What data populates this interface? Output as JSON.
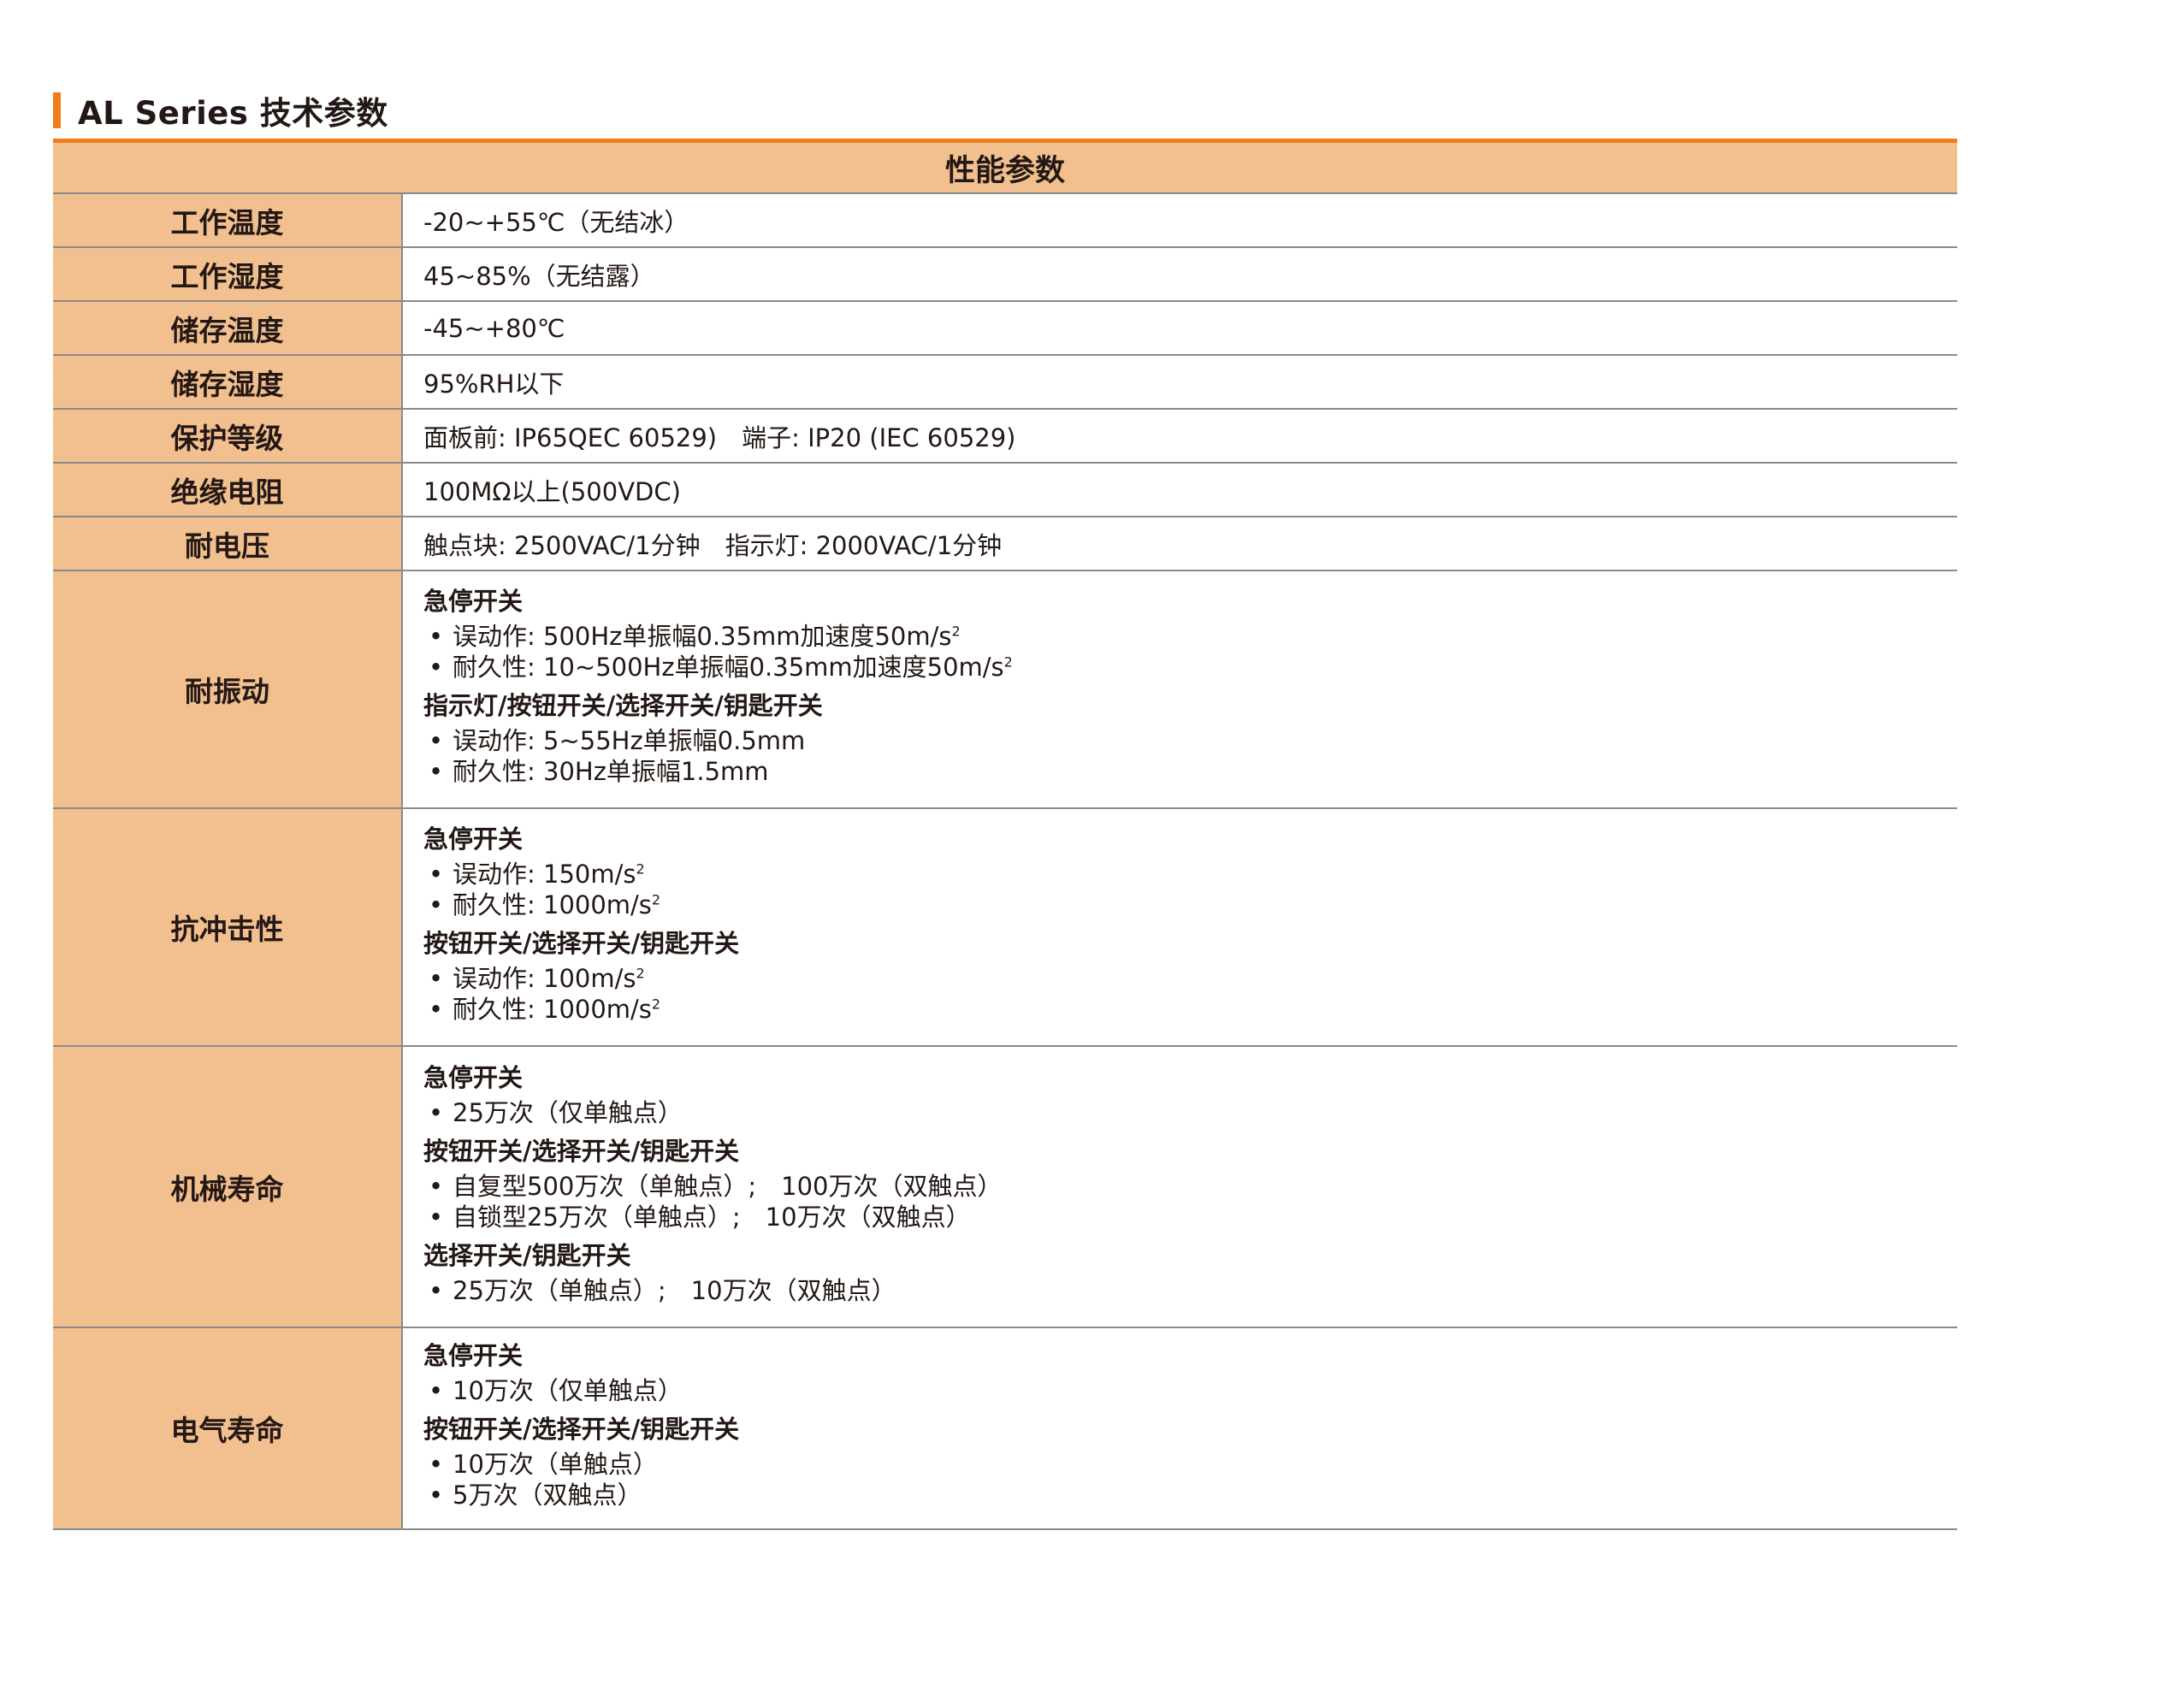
{
  "heading": {
    "title": "AL Series 技术参数",
    "accent": "#ee7d1e"
  },
  "table": {
    "header": "性能参数",
    "colors": {
      "label_bg": "#f2c08e",
      "accent_line": "#ee7d1e"
    },
    "simple_rows": [
      {
        "label": "工作温度",
        "value": "-20~+55℃（无结冰）"
      },
      {
        "label": "工作湿度",
        "value": "45~85%（无结露）"
      },
      {
        "label": "储存温度",
        "value": "-45~+80℃"
      },
      {
        "label": "储存湿度",
        "value": "95%RH以下"
      },
      {
        "label": "保护等级",
        "value": "面板前: IP65QEC 60529)　端子: IP20 (IEC 60529)"
      },
      {
        "label": "绝缘电阻",
        "value": "100MΩ以上(500VDC)"
      },
      {
        "label": "耐电压",
        "value": "触点块: 2500VAC/1分钟　指示灯: 2000VAC/1分钟"
      }
    ],
    "vibration": {
      "label": "耐振动",
      "groups": [
        {
          "title": "急停开关",
          "items": [
            "误动作: 500Hz单振幅0.35mm加速度50m/s",
            "耐久性: 10~500Hz单振幅0.35mm加速度50m/s"
          ],
          "sup": "2"
        },
        {
          "title": "指示灯/按钮开关/选择开关/钥匙开关",
          "items": [
            "误动作: 5~55Hz单振幅0.5mm",
            "耐久性: 30Hz单振幅1.5mm"
          ]
        }
      ]
    },
    "shock": {
      "label": "抗冲击性",
      "groups": [
        {
          "title": "急停开关",
          "items": [
            "误动作: 150m/s",
            "耐久性: 1000m/s"
          ],
          "sup": "2"
        },
        {
          "title": "按钮开关/选择开关/钥匙开关",
          "items": [
            "误动作: 100m/s",
            "耐久性: 1000m/s"
          ],
          "sup": "2"
        }
      ]
    },
    "mechanical": {
      "label": "机械寿命",
      "groups": [
        {
          "title": "急停开关",
          "items": [
            "25万次（仅单触点）"
          ]
        },
        {
          "title": "按钮开关/选择开关/钥匙开关",
          "items": [
            "自复型500万次（单触点）;　100万次（双触点）",
            "自锁型25万次（单触点）;　10万次（双触点）"
          ]
        },
        {
          "title": "选择开关/钥匙开关",
          "items": [
            "25万次（单触点）;　10万次（双触点）"
          ]
        }
      ]
    },
    "electrical": {
      "label": "电气寿命",
      "groups": [
        {
          "title": "急停开关",
          "items": [
            "10万次（仅单触点）"
          ]
        },
        {
          "title": "按钮开关/选择开关/钥匙开关",
          "items": [
            "10万次（单触点）",
            "5万次（双触点）"
          ]
        }
      ]
    }
  }
}
